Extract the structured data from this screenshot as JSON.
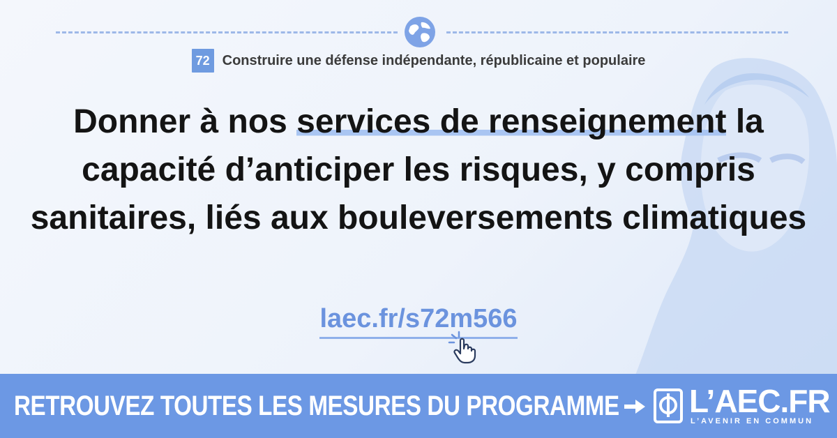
{
  "colors": {
    "accent": "#6c98e4",
    "highlight": "#a9c5f2",
    "link": "#6b93de",
    "headline": "#141414",
    "banner_text": "#ffffff"
  },
  "category": {
    "number": "72",
    "title": "Construire une défense indépendante, républicaine et populaire"
  },
  "headline": {
    "part1": "Donner à nos ",
    "highlighted": "services de renseignement",
    "part2": " la capacité d’anticiper les risques, y compris sanitaires, liés aux bouleversements climatiques"
  },
  "link": {
    "text": "laec.fr/s72m566"
  },
  "banner": {
    "text": "RETROUVEZ TOUTES LES MESURES DU PROGRAMME",
    "logo_text": "L’AEC.FR",
    "logo_subtitle": "L’AVENIR EN COMMUN"
  },
  "icons": [
    "globe-icon",
    "click-hand-icon",
    "arrow-right-icon",
    "phi-logo-icon",
    "portrait-silhouette"
  ]
}
